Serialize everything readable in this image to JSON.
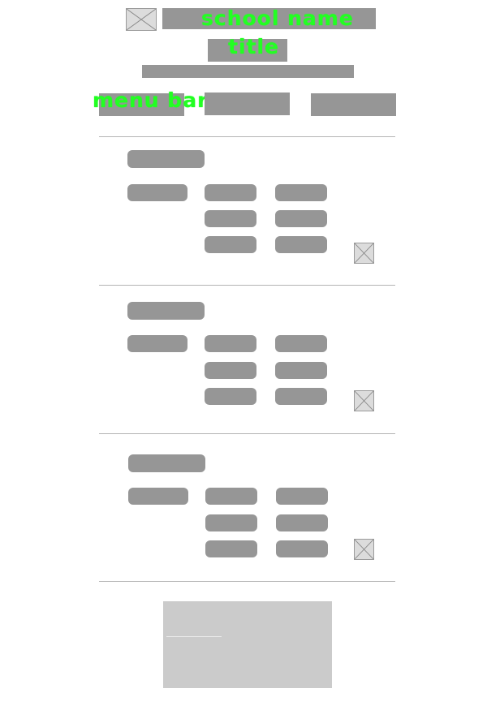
{
  "header": {
    "logo_icon": "image-placeholder-icon",
    "school_name_label": "school name",
    "title_label": "title",
    "menu_bar_label": "menu bar"
  },
  "sections": [
    {
      "image_icon": "image-placeholder-icon"
    },
    {
      "image_icon": "image-placeholder-icon"
    },
    {
      "image_icon": "image-placeholder-icon"
    }
  ],
  "colors": {
    "placeholder": "#969696",
    "annotation": "#22ff22",
    "footer": "#cbcbcb",
    "divider": "#b4b4b4"
  }
}
